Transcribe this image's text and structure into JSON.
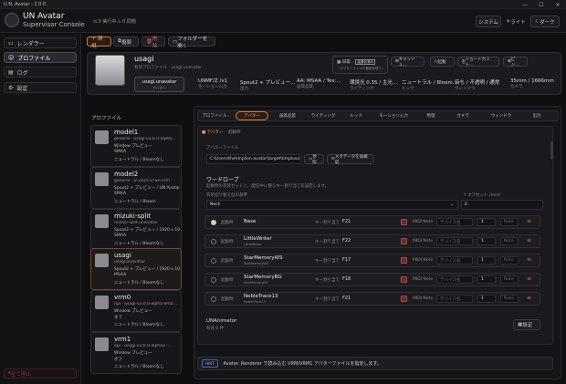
{
  "window": {
    "title": "U.N. Avatar - 2.0.0",
    "min": "—",
    "max": "☐",
    "close": "✕"
  },
  "app": {
    "title": "UN Avatar",
    "subtitle": "Supervisor Console",
    "running": "0 実行中",
    "problems": "0 問題"
  },
  "header": {
    "system": "システム",
    "light": "ライト",
    "dark": "ダーク"
  },
  "nav": [
    {
      "icon": "▭",
      "label": "レンダラー"
    },
    {
      "icon": "☺",
      "label": "プロファイル"
    },
    {
      "icon": "▤",
      "label": "ログ"
    },
    {
      "icon": "⚙",
      "label": "設定"
    }
  ],
  "kill": "全て停止",
  "toolbar": {
    "new": "＋ 新規",
    "copy": "複製",
    "delete": "削除",
    "open_folder": "フォルダーを開く"
  },
  "profile": {
    "name": "usagi",
    "desc": "有効プロファイル · usagi.unavatar",
    "chip": "usagi.unavatar",
    "chip_sub": "アバター",
    "stats": [
      {
        "v": "UNMF/Z /v1",
        "l": "モーション入力"
      },
      {
        "v": "Spout2 + プレビュー...",
        "l": "出力"
      },
      {
        "v": "AA: MSAA / Tex:...",
        "l": "画質品質"
      },
      {
        "v": "環境光 0.35 / 主光...",
        "l": "ライティング"
      },
      {
        "v": "ニュートラル / Bloom...",
        "l": "ルック"
      },
      {
        "v": "待ち / 不透明 / 通常",
        "l": "ウィンドウ"
      },
      {
        "v": "35mm / 1666mm",
        "l": "カメラ"
      }
    ],
    "log_btn": "日常...",
    "log_badge": "高速化済み",
    "log_desc": "このプロファイルの最新状態で...",
    "cache": "キャッシュ...",
    "start": "起動",
    "shortcut": "ショートカット...",
    "pin": "ピン..."
  },
  "profiles_label": "プロファイル",
  "profiles": [
    {
      "name": "model1",
      "l2": "general · usagi-v3.0.0-alpha...",
      "l3": "Window プレビュー",
      "l4": "SMAA",
      "l5": "ニュートラル / Bloomなし"
    },
    {
      "name": "model2",
      "l2": "general · U-2025-D-SH.vrm",
      "l3": "Spout2 + プレビュー / UN Avatar S...",
      "l4": "SMAA",
      "l5": "ニュートラル / Bloom"
    },
    {
      "name": "mizuki-split",
      "l2": "mizuki-split.unavatar",
      "l3": "Spout2 + プレビュー / 1920 x 1080...",
      "l4": "SMAA",
      "l5": "ニュートラル / Bloomなし"
    },
    {
      "name": "usagi",
      "l2": "usagi.unavatar",
      "l3": "Spout2 + プレビュー / 1920 x 1080...",
      "l4": "MSAA",
      "l5": "ニュートラル / Bloomなし"
    },
    {
      "name": "vrm0",
      "l2": "npi · usagi-v3.0.0-alpha-ema...",
      "l3": "Window プレビュー",
      "l4": "オフ",
      "l5": "ニュートラル / Bloomなし"
    },
    {
      "name": "vrm1",
      "l2": "npi · usagi-v3.0.0-alpha3 ·...",
      "l3": "Window プレビュー",
      "l4": "オフ",
      "l5": "ニュートラル / Bloomなし"
    }
  ],
  "tabs": [
    "プロファイル...",
    "アバター",
    "画質品質",
    "ライティング",
    "ルック",
    "モーション入力",
    "物理",
    "カメラ",
    "ウィンドウ",
    "出力"
  ],
  "panel": {
    "tag": "アバター",
    "tag_sub": "起動時",
    "file_label": "アバターファイル",
    "file_path": "C:\\Users\\the\\implion-avatar\\target\\timplusa",
    "browse": "参照",
    "meta": "メタデータを再確認",
    "wardrobe": "ワードローブ",
    "wardrobe_desc": "起動時の衣装セットと、配信中に使うキー割り当てを設定します。",
    "switch_label": "衣装切り替え位の基準",
    "offset_label": "Y オフセット (mm)",
    "switch_val": "Neck",
    "offset_val": "0",
    "rows": [
      {
        "on": true,
        "start": "起動時",
        "name": "Base",
        "sub": "",
        "key": "F21"
      },
      {
        "on": false,
        "start": "起動時",
        "name": "LittleWriter",
        "sub": "LittleWriter",
        "key": "F22"
      },
      {
        "on": false,
        "start": "起動時",
        "name": "StarMemoryWS",
        "sub": "StarMemoryWS",
        "key": "F17"
      },
      {
        "on": false,
        "start": "起動時",
        "name": "StarMemoryBG",
        "sub": "StarMemoryBG",
        "key": "F18"
      },
      {
        "on": false,
        "start": "起動時",
        "name": "NobleTrace13",
        "sub": "NobleTrace13",
        "key": "F21"
      }
    ],
    "key_label": "キー割り当て",
    "midi": "MIDI Note",
    "device": "デバイス名",
    "num": "1",
    "note": "Note",
    "animator": "UNAnimator",
    "animator_sub": "有効 0 件",
    "settings": "設定"
  },
  "hint": {
    "badge": "HINT",
    "text": "Avatar: Renderer で読み込む VRM/VRM1 アバターファイルを指定します。"
  }
}
